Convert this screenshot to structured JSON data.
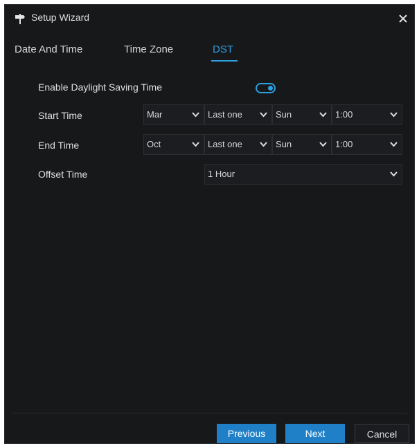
{
  "window": {
    "title": "Setup Wizard"
  },
  "tabs": [
    {
      "label": "Date And Time",
      "active": false
    },
    {
      "label": "Time Zone",
      "active": false
    },
    {
      "label": "DST",
      "active": true
    }
  ],
  "dst": {
    "enable_label": "Enable Daylight Saving Time",
    "enabled": true,
    "start_label": "Start Time",
    "end_label": "End Time",
    "offset_label": "Offset Time",
    "start": {
      "month": "Mar",
      "week": "Last one",
      "day": "Sun",
      "time": "1:00"
    },
    "end": {
      "month": "Oct",
      "week": "Last one",
      "day": "Sun",
      "time": "1:00"
    },
    "offset": "1 Hour"
  },
  "footer": {
    "previous": "Previous",
    "next": "Next",
    "cancel": "Cancel"
  },
  "colors": {
    "accent": "#2e9fe0",
    "button_primary": "#1f80c8",
    "background": "#17181a"
  },
  "icons": {
    "title": "signpost-icon",
    "close": "close-icon",
    "dropdown": "chevron-down-icon"
  }
}
